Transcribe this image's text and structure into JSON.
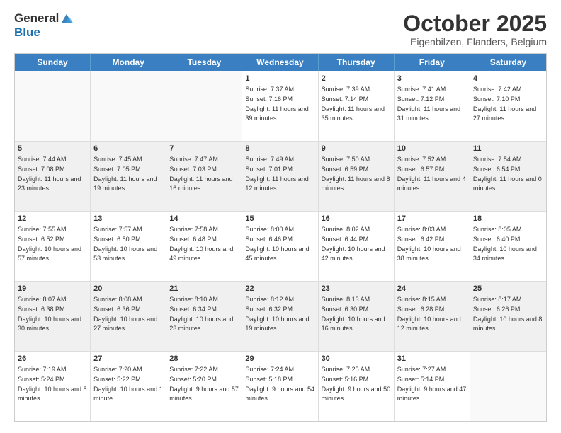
{
  "header": {
    "logo_line1": "General",
    "logo_line2": "Blue",
    "month": "October 2025",
    "location": "Eigenbilzen, Flanders, Belgium"
  },
  "days_of_week": [
    "Sunday",
    "Monday",
    "Tuesday",
    "Wednesday",
    "Thursday",
    "Friday",
    "Saturday"
  ],
  "weeks": [
    [
      {
        "day": "",
        "sunrise": "",
        "sunset": "",
        "daylight": "",
        "empty": true
      },
      {
        "day": "",
        "sunrise": "",
        "sunset": "",
        "daylight": "",
        "empty": true
      },
      {
        "day": "",
        "sunrise": "",
        "sunset": "",
        "daylight": "",
        "empty": true
      },
      {
        "day": "1",
        "sunrise": "Sunrise: 7:37 AM",
        "sunset": "Sunset: 7:16 PM",
        "daylight": "Daylight: 11 hours and 39 minutes."
      },
      {
        "day": "2",
        "sunrise": "Sunrise: 7:39 AM",
        "sunset": "Sunset: 7:14 PM",
        "daylight": "Daylight: 11 hours and 35 minutes."
      },
      {
        "day": "3",
        "sunrise": "Sunrise: 7:41 AM",
        "sunset": "Sunset: 7:12 PM",
        "daylight": "Daylight: 11 hours and 31 minutes."
      },
      {
        "day": "4",
        "sunrise": "Sunrise: 7:42 AM",
        "sunset": "Sunset: 7:10 PM",
        "daylight": "Daylight: 11 hours and 27 minutes."
      }
    ],
    [
      {
        "day": "5",
        "sunrise": "Sunrise: 7:44 AM",
        "sunset": "Sunset: 7:08 PM",
        "daylight": "Daylight: 11 hours and 23 minutes."
      },
      {
        "day": "6",
        "sunrise": "Sunrise: 7:45 AM",
        "sunset": "Sunset: 7:05 PM",
        "daylight": "Daylight: 11 hours and 19 minutes."
      },
      {
        "day": "7",
        "sunrise": "Sunrise: 7:47 AM",
        "sunset": "Sunset: 7:03 PM",
        "daylight": "Daylight: 11 hours and 16 minutes."
      },
      {
        "day": "8",
        "sunrise": "Sunrise: 7:49 AM",
        "sunset": "Sunset: 7:01 PM",
        "daylight": "Daylight: 11 hours and 12 minutes."
      },
      {
        "day": "9",
        "sunrise": "Sunrise: 7:50 AM",
        "sunset": "Sunset: 6:59 PM",
        "daylight": "Daylight: 11 hours and 8 minutes."
      },
      {
        "day": "10",
        "sunrise": "Sunrise: 7:52 AM",
        "sunset": "Sunset: 6:57 PM",
        "daylight": "Daylight: 11 hours and 4 minutes."
      },
      {
        "day": "11",
        "sunrise": "Sunrise: 7:54 AM",
        "sunset": "Sunset: 6:54 PM",
        "daylight": "Daylight: 11 hours and 0 minutes."
      }
    ],
    [
      {
        "day": "12",
        "sunrise": "Sunrise: 7:55 AM",
        "sunset": "Sunset: 6:52 PM",
        "daylight": "Daylight: 10 hours and 57 minutes."
      },
      {
        "day": "13",
        "sunrise": "Sunrise: 7:57 AM",
        "sunset": "Sunset: 6:50 PM",
        "daylight": "Daylight: 10 hours and 53 minutes."
      },
      {
        "day": "14",
        "sunrise": "Sunrise: 7:58 AM",
        "sunset": "Sunset: 6:48 PM",
        "daylight": "Daylight: 10 hours and 49 minutes."
      },
      {
        "day": "15",
        "sunrise": "Sunrise: 8:00 AM",
        "sunset": "Sunset: 6:46 PM",
        "daylight": "Daylight: 10 hours and 45 minutes."
      },
      {
        "day": "16",
        "sunrise": "Sunrise: 8:02 AM",
        "sunset": "Sunset: 6:44 PM",
        "daylight": "Daylight: 10 hours and 42 minutes."
      },
      {
        "day": "17",
        "sunrise": "Sunrise: 8:03 AM",
        "sunset": "Sunset: 6:42 PM",
        "daylight": "Daylight: 10 hours and 38 minutes."
      },
      {
        "day": "18",
        "sunrise": "Sunrise: 8:05 AM",
        "sunset": "Sunset: 6:40 PM",
        "daylight": "Daylight: 10 hours and 34 minutes."
      }
    ],
    [
      {
        "day": "19",
        "sunrise": "Sunrise: 8:07 AM",
        "sunset": "Sunset: 6:38 PM",
        "daylight": "Daylight: 10 hours and 30 minutes."
      },
      {
        "day": "20",
        "sunrise": "Sunrise: 8:08 AM",
        "sunset": "Sunset: 6:36 PM",
        "daylight": "Daylight: 10 hours and 27 minutes."
      },
      {
        "day": "21",
        "sunrise": "Sunrise: 8:10 AM",
        "sunset": "Sunset: 6:34 PM",
        "daylight": "Daylight: 10 hours and 23 minutes."
      },
      {
        "day": "22",
        "sunrise": "Sunrise: 8:12 AM",
        "sunset": "Sunset: 6:32 PM",
        "daylight": "Daylight: 10 hours and 19 minutes."
      },
      {
        "day": "23",
        "sunrise": "Sunrise: 8:13 AM",
        "sunset": "Sunset: 6:30 PM",
        "daylight": "Daylight: 10 hours and 16 minutes."
      },
      {
        "day": "24",
        "sunrise": "Sunrise: 8:15 AM",
        "sunset": "Sunset: 6:28 PM",
        "daylight": "Daylight: 10 hours and 12 minutes."
      },
      {
        "day": "25",
        "sunrise": "Sunrise: 8:17 AM",
        "sunset": "Sunset: 6:26 PM",
        "daylight": "Daylight: 10 hours and 8 minutes."
      }
    ],
    [
      {
        "day": "26",
        "sunrise": "Sunrise: 7:19 AM",
        "sunset": "Sunset: 5:24 PM",
        "daylight": "Daylight: 10 hours and 5 minutes."
      },
      {
        "day": "27",
        "sunrise": "Sunrise: 7:20 AM",
        "sunset": "Sunset: 5:22 PM",
        "daylight": "Daylight: 10 hours and 1 minute."
      },
      {
        "day": "28",
        "sunrise": "Sunrise: 7:22 AM",
        "sunset": "Sunset: 5:20 PM",
        "daylight": "Daylight: 9 hours and 57 minutes."
      },
      {
        "day": "29",
        "sunrise": "Sunrise: 7:24 AM",
        "sunset": "Sunset: 5:18 PM",
        "daylight": "Daylight: 9 hours and 54 minutes."
      },
      {
        "day": "30",
        "sunrise": "Sunrise: 7:25 AM",
        "sunset": "Sunset: 5:16 PM",
        "daylight": "Daylight: 9 hours and 50 minutes."
      },
      {
        "day": "31",
        "sunrise": "Sunrise: 7:27 AM",
        "sunset": "Sunset: 5:14 PM",
        "daylight": "Daylight: 9 hours and 47 minutes."
      },
      {
        "day": "",
        "sunrise": "",
        "sunset": "",
        "daylight": "",
        "empty": true
      }
    ]
  ]
}
